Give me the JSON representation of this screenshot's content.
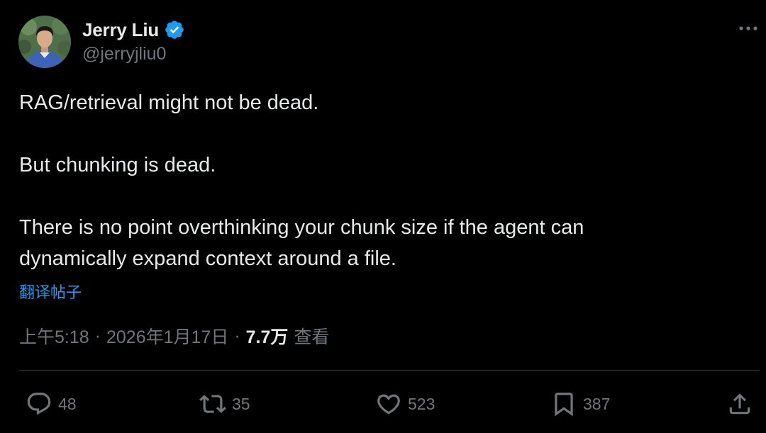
{
  "author": {
    "display_name": "Jerry Liu",
    "handle": "@jerryjliu0",
    "verified": true,
    "avatar": "profile-photo"
  },
  "tweet": {
    "lines": [
      "RAG/retrieval might not be dead.",
      "But chunking is dead.",
      "There is no point overthinking your chunk size if the agent can",
      "dynamically expand context around a file."
    ],
    "translate_label": "翻译帖子"
  },
  "meta": {
    "time": "上午5:18",
    "separator": "·",
    "date": "2026年1月17日",
    "views_count": "7.7万",
    "views_label": "查看"
  },
  "actions": {
    "reply_count": "48",
    "retweet_count": "35",
    "like_count": "523",
    "bookmark_count": "387"
  },
  "icons": {
    "more": "more-horizontal-icon",
    "reply": "reply-icon",
    "retweet": "retweet-icon",
    "like": "heart-icon",
    "bookmark": "bookmark-icon",
    "share": "share-icon",
    "verified": "verified-badge-icon"
  },
  "colors": {
    "background": "#000000",
    "text": "#e7e9ea",
    "secondary": "#71767b",
    "accent": "#1d9bf0",
    "divider": "#2f3336"
  }
}
